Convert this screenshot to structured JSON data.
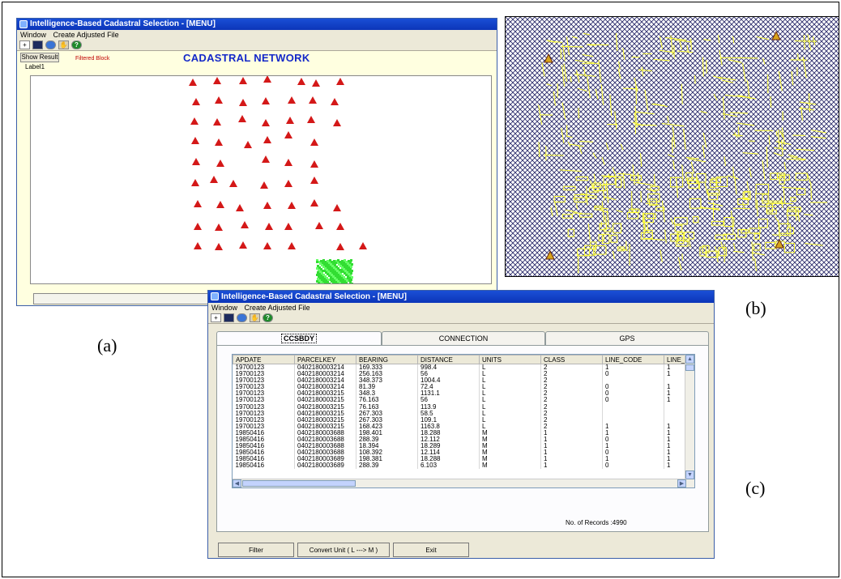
{
  "captions": {
    "a": "(a)",
    "b": "(b)",
    "c": "(c)"
  },
  "window_a": {
    "title": "Intelligence-Based Cadastral Selection - [MENU]",
    "menu": [
      "Window",
      "Create Adjusted File"
    ],
    "show_result_label": "Show Result",
    "filtered_block_label": "Filtered Block",
    "label1": "Label1",
    "heading": "CADASTRAL NETWORK"
  },
  "window_c": {
    "title": "Intelligence-Based Cadastral Selection - [MENU]",
    "menu": [
      "Window",
      "Create Adjusted File"
    ],
    "tabs": [
      "CCSBDY",
      "CONNECTION",
      "GPS"
    ],
    "columns": [
      "APDATE",
      "PARCELKEY",
      "BEARING",
      "DISTANCE",
      "UNITS",
      "CLASS",
      "LINE_CODE",
      "LINE_"
    ],
    "rows": [
      [
        "19700123",
        "0402180003214",
        "169.333",
        "998.4",
        "L",
        "2",
        "1",
        "1"
      ],
      [
        "19700123",
        "0402180003214",
        "256.163",
        "56",
        "L",
        "2",
        "0",
        "1"
      ],
      [
        "19700123",
        "0402180003214",
        "348.373",
        "1004.4",
        "L",
        "2",
        "",
        ""
      ],
      [
        "19700123",
        "0402180003214",
        "81.39",
        "72.4",
        "L",
        "2",
        "0",
        "1"
      ],
      [
        "19700123",
        "0402180003215",
        "348.3",
        "1131.1",
        "L",
        "2",
        "0",
        "1"
      ],
      [
        "19700123",
        "0402180003215",
        "76.163",
        "56",
        "L",
        "2",
        "0",
        "1"
      ],
      [
        "19700123",
        "0402180003215",
        "76.163",
        "113.9",
        "L",
        "2",
        "",
        ""
      ],
      [
        "19700123",
        "0402180003215",
        "267.303",
        "58.5",
        "L",
        "2",
        "",
        ""
      ],
      [
        "19700123",
        "0402180003215",
        "267.303",
        "109.1",
        "L",
        "2",
        "",
        ""
      ],
      [
        "19700123",
        "0402180003215",
        "168.423",
        "1163.8",
        "L",
        "2",
        "1",
        "1"
      ],
      [
        "19850416",
        "0402180003688",
        "198.401",
        "18.288",
        "M",
        "1",
        "1",
        "1"
      ],
      [
        "19850416",
        "0402180003688",
        "288.39",
        "12.112",
        "M",
        "1",
        "0",
        "1"
      ],
      [
        "19850416",
        "0402180003688",
        "18.394",
        "18.289",
        "M",
        "1",
        "1",
        "1"
      ],
      [
        "19850416",
        "0402180003688",
        "108.392",
        "12.114",
        "M",
        "1",
        "0",
        "1"
      ],
      [
        "19850416",
        "0402180003689",
        "198.381",
        "18.288",
        "M",
        "1",
        "1",
        "1"
      ],
      [
        "19850416",
        "0402180003689",
        "288.39",
        "6.103",
        "M",
        "1",
        "0",
        "1"
      ]
    ],
    "records_label": "No. of Records :4990",
    "buttons": {
      "filter": "Filter",
      "convert": "Convert Unit ( L ---> M )",
      "exit": "Exit"
    }
  },
  "colors": {
    "marker": "#d41818",
    "filtered_block": "#33dd33",
    "parcel_lines": "#ffff33",
    "hatch": "#2b2b6b",
    "title_blue": "#1428c8"
  }
}
